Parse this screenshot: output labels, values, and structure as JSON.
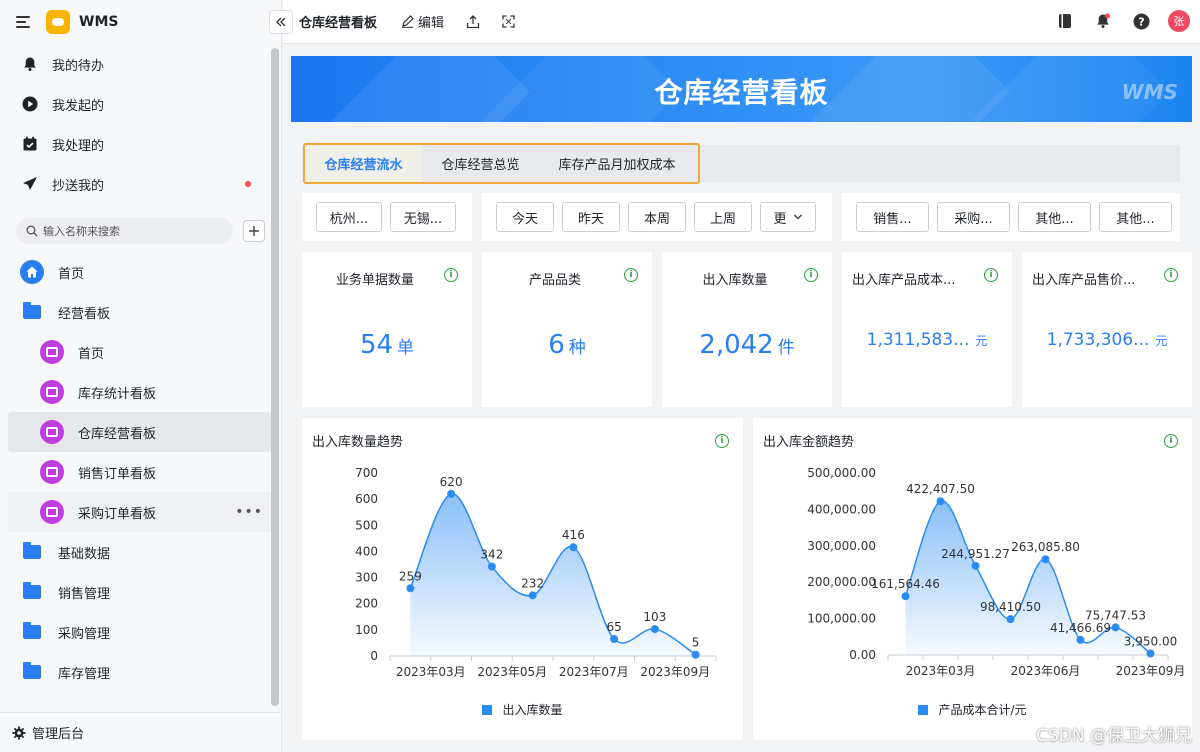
{
  "app": {
    "name": "WMS"
  },
  "sidebar": {
    "quick": [
      {
        "label": "我的待办",
        "icon": "bell-icon"
      },
      {
        "label": "我发起的",
        "icon": "play-circle-icon"
      },
      {
        "label": "我处理的",
        "icon": "check-calendar-icon"
      },
      {
        "label": "抄送我的",
        "icon": "send-icon",
        "has_dot": true
      }
    ],
    "search_placeholder": "输入名称来搜索",
    "nav": [
      {
        "label": "首页",
        "type": "home"
      },
      {
        "label": "经营看板",
        "type": "folder"
      },
      {
        "label": "首页",
        "type": "board",
        "sub": true
      },
      {
        "label": "库存统计看板",
        "type": "board",
        "sub": true
      },
      {
        "label": "仓库经营看板",
        "type": "board",
        "sub": true,
        "active": true
      },
      {
        "label": "销售订单看板",
        "type": "board",
        "sub": true
      },
      {
        "label": "采购订单看板",
        "type": "board",
        "sub": true,
        "hover": true
      },
      {
        "label": "基础数据",
        "type": "folder"
      },
      {
        "label": "销售管理",
        "type": "folder"
      },
      {
        "label": "采购管理",
        "type": "folder"
      },
      {
        "label": "库存管理",
        "type": "folder"
      }
    ],
    "footer": "管理后台"
  },
  "topbar": {
    "title": "仓库经营看板",
    "edit": "编辑",
    "avatar": "张"
  },
  "banner": {
    "title": "仓库经营看板",
    "logo": "WMS"
  },
  "tabs": [
    "仓库经营流水",
    "仓库经营总览",
    "库存产品月加权成本"
  ],
  "filters": {
    "warehouse": [
      "杭州...",
      "无锡..."
    ],
    "period": [
      "今天",
      "昨天",
      "本周",
      "上周",
      "更"
    ],
    "types": [
      "销售...",
      "采购...",
      "其他...",
      "其他..."
    ]
  },
  "kpis": [
    {
      "title": "业务单据数量",
      "value": "54",
      "unit": "单"
    },
    {
      "title": "产品品类",
      "value": "6",
      "unit": "种"
    },
    {
      "title": "出入库数量",
      "value": "2,042",
      "unit": "件"
    },
    {
      "title": "出入库产品成本...",
      "value": "1,311,583...",
      "unit": "元"
    },
    {
      "title": "出入库产品售价...",
      "value": "1,733,306...",
      "unit": "元"
    }
  ],
  "chart_data": [
    {
      "type": "area",
      "title": "出入库数量趋势",
      "x_ticks": [
        "2023年03月",
        "2023年05月",
        "2023年07月",
        "2023年09月"
      ],
      "x_index": [
        0,
        1,
        2,
        3,
        4,
        5,
        6,
        7
      ],
      "values": [
        259,
        620,
        342,
        232,
        416,
        65,
        103,
        5
      ],
      "labels": [
        "259",
        "620",
        "342",
        "232",
        "416",
        "65",
        "103",
        "5"
      ],
      "y_ticks": [
        "0",
        "100",
        "200",
        "300",
        "400",
        "500",
        "600",
        "700"
      ],
      "ylim": [
        0,
        700
      ],
      "legend": "出入库数量",
      "color": "#2a8bf2"
    },
    {
      "type": "area",
      "title": "出入库金额趋势",
      "x_ticks": [
        "2023年03月",
        "2023年06月",
        "2023年09月"
      ],
      "x_index": [
        0,
        1,
        2,
        3,
        4,
        5,
        6,
        7
      ],
      "values": [
        161564.46,
        422407.5,
        244951.27,
        98410.5,
        263085.8,
        41466.69,
        75747.53,
        3950.0
      ],
      "labels": [
        "161,564.46",
        "422,407.50",
        "244,951.27",
        "98,410.50",
        "263,085.80",
        "41,466.69",
        "75,747.53",
        "3,950.00"
      ],
      "y_ticks": [
        "0.00",
        "100,000.00",
        "200,000.00",
        "300,000.00",
        "400,000.00",
        "500,000.00"
      ],
      "ylim": [
        0,
        500000
      ],
      "legend": "产品成本合计/元",
      "color": "#2a8bf2"
    }
  ],
  "watermark": "CSDN @保卫大狮兄"
}
